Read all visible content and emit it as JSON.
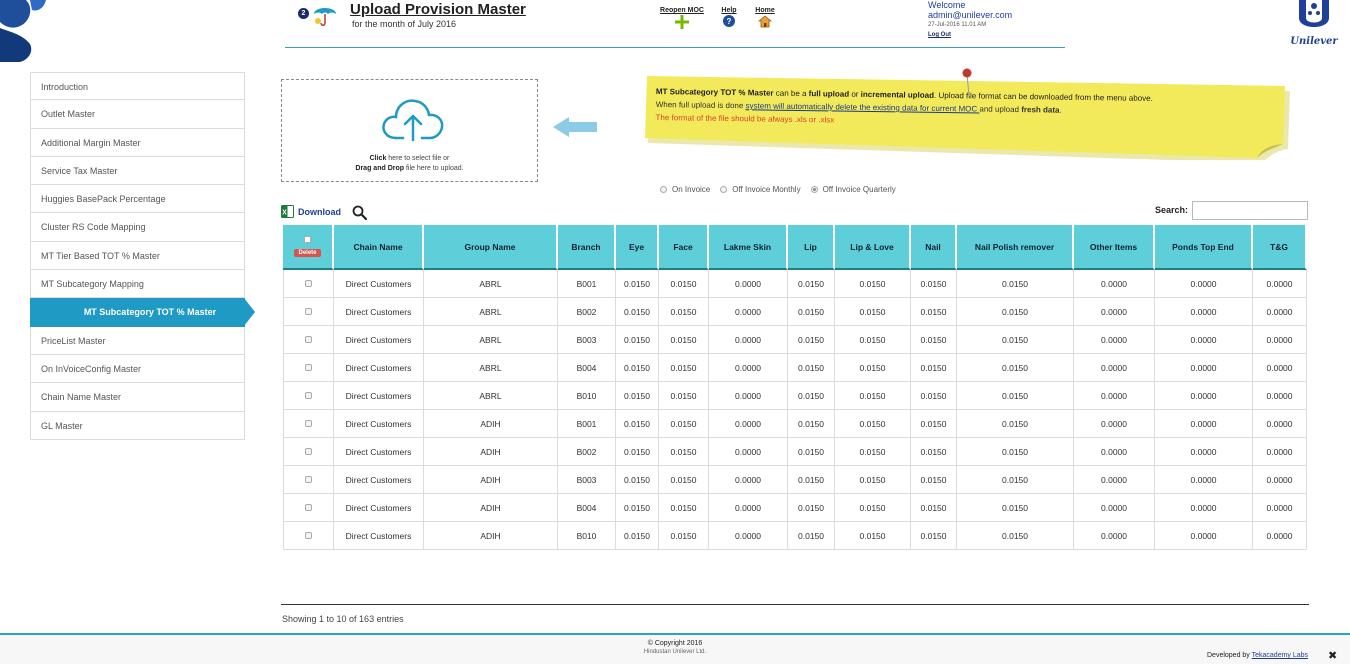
{
  "header": {
    "step_number": "2",
    "title": "Upload Provision Master",
    "subtitle": "for the month of July 2016",
    "nav": {
      "reopen_label": "Reopen MOC",
      "help_label": "Help",
      "home_label": "Home"
    },
    "user": {
      "welcome": "Welcome",
      "email": "admin@unilever.com",
      "datetime": "27-Jul-2016 11.01 AM",
      "logout": "Log Out"
    },
    "brand": "Unilever"
  },
  "sidebar": {
    "items": [
      {
        "label": "Introduction"
      },
      {
        "label": "Outlet Master"
      },
      {
        "label": "Additional Margin Master"
      },
      {
        "label": "Service Tax Master"
      },
      {
        "label": "Huggies BasePack Percentage"
      },
      {
        "label": "Cluster RS Code Mapping"
      },
      {
        "label": "MT Tier Based TOT % Master"
      },
      {
        "label": "MT Subcategory Mapping"
      },
      {
        "label": "MT Subcategory TOT % Master",
        "active": true
      },
      {
        "label": "PriceList Master"
      },
      {
        "label": "On InVoiceConfig Master"
      },
      {
        "label": "Chain Name Master"
      },
      {
        "label": "GL Master"
      }
    ]
  },
  "upload": {
    "click_bold": "Click",
    "click_rest": " here to select file or",
    "drag_bold": "Drag and Drop",
    "drag_rest": " file here to upload."
  },
  "note": {
    "l1_a": "MT Subcategory TOT % Master",
    "l1_b": " can be a ",
    "l1_c": "full upload",
    "l1_d": " or ",
    "l1_e": "incremental upload",
    "l1_f": ". Upload file format can be downloaded from the menu above.",
    "l2_a": "When full upload is done ",
    "l2_b": "system will automatically delete the existing data for current MOC ",
    "l2_c": "and upload ",
    "l2_d": "fresh data",
    "l2_e": ".",
    "l3": "The format of the file should be always .xls or .xlsx"
  },
  "radios": [
    {
      "label": "On Invoice",
      "checked": false
    },
    {
      "label": "Off Invoice Monthly",
      "checked": false
    },
    {
      "label": "Off Invoice Quarterly",
      "checked": true
    }
  ],
  "toolbar": {
    "download_label": "Download",
    "search_label": "Search:"
  },
  "table": {
    "delete_label": "Delete",
    "columns": [
      "Chain Name",
      "Group Name",
      "Branch",
      "Eye",
      "Face",
      "Lakme Skin",
      "Lip",
      "Lip & Love",
      "Nail",
      "Nail Polish remover",
      "Other Items",
      "Ponds Top End",
      "T&G"
    ],
    "rows": [
      [
        "Direct Customers",
        "ABRL",
        "B001",
        "0.0150",
        "0.0150",
        "0.0000",
        "0.0150",
        "0.0150",
        "0.0150",
        "0.0150",
        "0.0000",
        "0.0000",
        "0.0000"
      ],
      [
        "Direct Customers",
        "ABRL",
        "B002",
        "0.0150",
        "0.0150",
        "0.0000",
        "0.0150",
        "0.0150",
        "0.0150",
        "0.0150",
        "0.0000",
        "0.0000",
        "0.0000"
      ],
      [
        "Direct Customers",
        "ABRL",
        "B003",
        "0.0150",
        "0.0150",
        "0.0000",
        "0.0150",
        "0.0150",
        "0.0150",
        "0.0150",
        "0.0000",
        "0.0000",
        "0.0000"
      ],
      [
        "Direct Customers",
        "ABRL",
        "B004",
        "0.0150",
        "0.0150",
        "0.0000",
        "0.0150",
        "0.0150",
        "0.0150",
        "0.0150",
        "0.0000",
        "0.0000",
        "0.0000"
      ],
      [
        "Direct Customers",
        "ABRL",
        "B010",
        "0.0150",
        "0.0150",
        "0.0000",
        "0.0150",
        "0.0150",
        "0.0150",
        "0.0150",
        "0.0000",
        "0.0000",
        "0.0000"
      ],
      [
        "Direct Customers",
        "ADIH",
        "B001",
        "0.0150",
        "0.0150",
        "0.0000",
        "0.0150",
        "0.0150",
        "0.0150",
        "0.0150",
        "0.0000",
        "0.0000",
        "0.0000"
      ],
      [
        "Direct Customers",
        "ADIH",
        "B002",
        "0.0150",
        "0.0150",
        "0.0000",
        "0.0150",
        "0.0150",
        "0.0150",
        "0.0150",
        "0.0000",
        "0.0000",
        "0.0000"
      ],
      [
        "Direct Customers",
        "ADIH",
        "B003",
        "0.0150",
        "0.0150",
        "0.0000",
        "0.0150",
        "0.0150",
        "0.0150",
        "0.0150",
        "0.0000",
        "0.0000",
        "0.0000"
      ],
      [
        "Direct Customers",
        "ADIH",
        "B004",
        "0.0150",
        "0.0150",
        "0.0000",
        "0.0150",
        "0.0150",
        "0.0150",
        "0.0150",
        "0.0000",
        "0.0000",
        "0.0000"
      ],
      [
        "Direct Customers",
        "ADIH",
        "B010",
        "0.0150",
        "0.0150",
        "0.0000",
        "0.0150",
        "0.0150",
        "0.0150",
        "0.0150",
        "0.0000",
        "0.0000",
        "0.0000"
      ]
    ],
    "info": "Showing 1 to 10 of 163 entries"
  },
  "footer": {
    "copyright": "Copyright 2016",
    "org": "Hindustan Unilever Ltd.",
    "developed_by": "Developed by ",
    "developer": "Tekacademy Labs"
  },
  "colors": {
    "accent": "#1e9ac4",
    "table_header": "#5ecfd8",
    "note_yellow": "#f2ea5a",
    "delete_red": "#d9534f"
  }
}
